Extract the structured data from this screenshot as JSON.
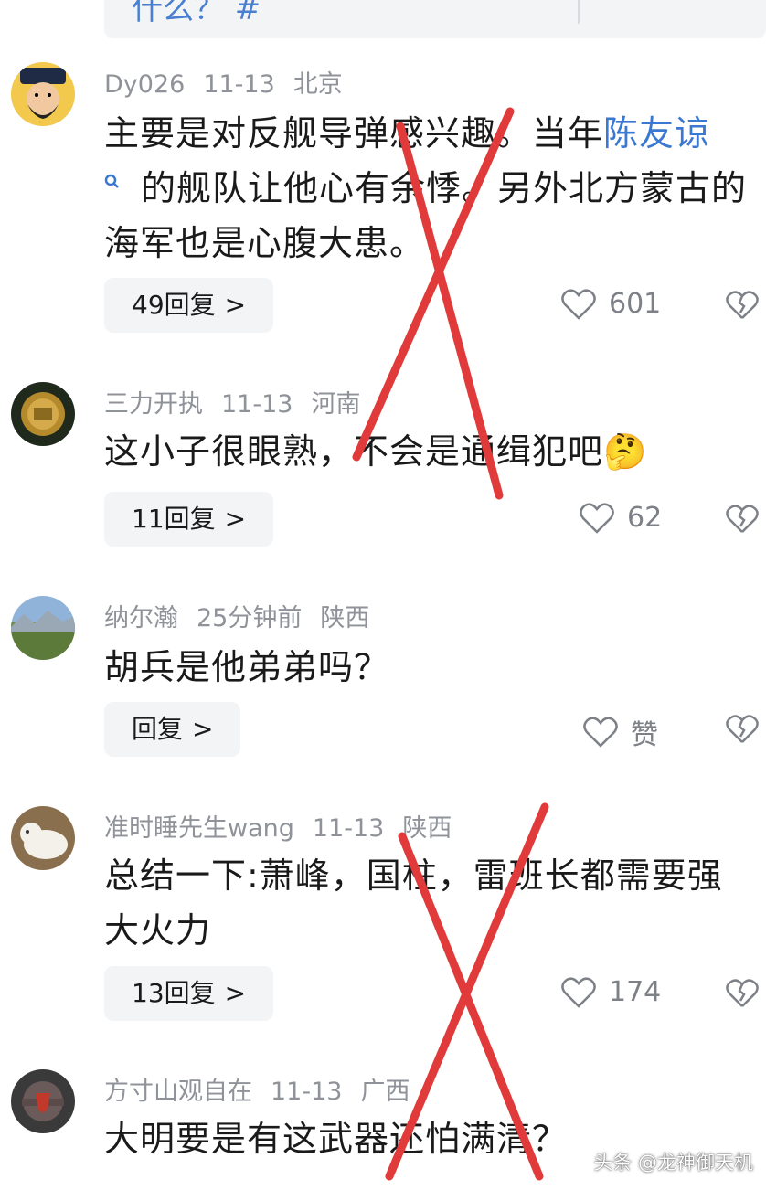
{
  "top_card": {
    "partial_text": "什么？ #"
  },
  "comments": [
    {
      "user": "Dy026",
      "time": "11-13",
      "location": "北京",
      "text_before": "主要是对反舰导弹感兴趣。当年",
      "link": "陈友谅",
      "text_after": "的舰队让他心有余悸。另外北方蒙古的海军也是心腹大患。",
      "replies": "49回复",
      "likes": "601"
    },
    {
      "user": "三力开执",
      "time": "11-13",
      "location": "河南",
      "text": "这小子很眼熟，不会是通缉犯吧",
      "emoji": "🤔",
      "replies": "11回复",
      "likes": "62"
    },
    {
      "user": "纳尔瀚",
      "time": "25分钟前",
      "location": "陕西",
      "text": "胡兵是他弟弟吗？",
      "replies": "回复",
      "likes": "赞"
    },
    {
      "user": "准时睡先生wang",
      "time": "11-13",
      "location": "陕西",
      "text": "总结一下:萧峰，国柱，雷班长都需要强大火力",
      "replies": "13回复",
      "likes": "174"
    },
    {
      "user": "方寸山观自在",
      "time": "11-13",
      "location": "广西",
      "text": "大明要是有这武器还怕满清？"
    }
  ],
  "reply_chevron": ">",
  "icons": {
    "search": "search-icon",
    "like": "heart-icon",
    "dislike": "broken-heart-icon"
  },
  "colors": {
    "link": "#3a78d1",
    "meta": "#8f9399",
    "x_mark": "#e03a3a"
  },
  "watermark": "头条 @龙神御天机"
}
